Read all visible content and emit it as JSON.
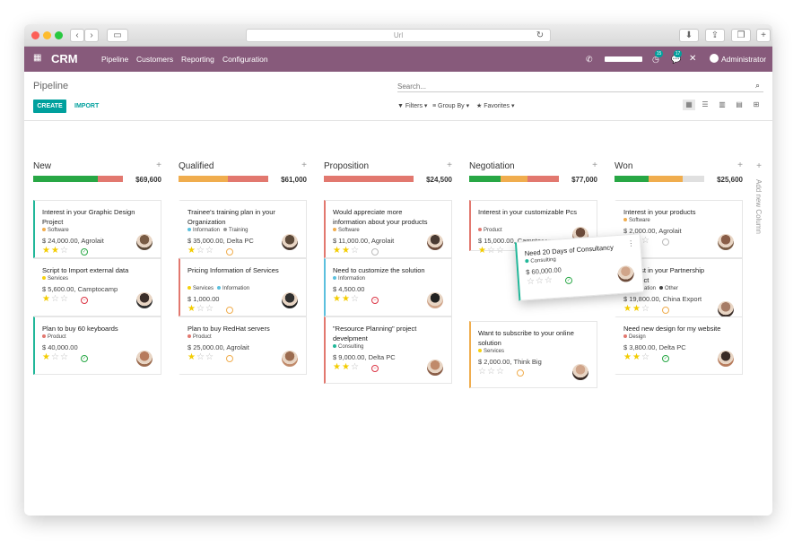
{
  "app": {
    "title": "CRM",
    "url_placeholder": "Url"
  },
  "nav": {
    "menus": [
      "Pipeline",
      "Customers",
      "Reporting",
      "Configuration"
    ],
    "user": "Administrator",
    "badge_activities": "15",
    "badge_messages": "17"
  },
  "breadcrumb": "Pipeline",
  "buttons": {
    "create": "CREATE",
    "import": "IMPORT"
  },
  "search": {
    "placeholder": "Search..."
  },
  "filters": {
    "filters": "Filters",
    "group_by": "Group By",
    "favorites": "Favorites"
  },
  "add_column": "Add new Column",
  "colors": {
    "brand": "#875a7b",
    "accent": "#00a09d",
    "green": "#21b799",
    "red": "#e2786f",
    "orange": "#f0ad4e",
    "grey": "#e0e0e0"
  },
  "columns": [
    {
      "name": "New",
      "total": "$69,600",
      "progress": [
        {
          "color": "#28a745",
          "pct": 0.72
        },
        {
          "color": "#e2786f",
          "pct": 0.28
        }
      ],
      "cards": [
        {
          "title": "Interest in your Graphic Design Project",
          "tags": [
            {
              "name": "Software",
              "color": "#f0ad4e"
            }
          ],
          "amount": "$ 24,000.00, Agrolait",
          "stars": 2,
          "status": "green",
          "border": "#21b799",
          "avatar": "a1"
        },
        {
          "title": "Script to Import external data",
          "tags": [
            {
              "name": "Services",
              "color": "#f5d10f"
            }
          ],
          "amount": "$ 5,600.00, Camptocamp",
          "stars": 1,
          "status": "red",
          "border": "",
          "avatar": "a2"
        },
        {
          "title": "Plan to buy 60 keyboards",
          "tags": [
            {
              "name": "Product",
              "color": "#e2786f"
            }
          ],
          "amount": "$ 40,000.00",
          "stars": 1,
          "status": "green",
          "border": "#21b799",
          "avatar": "a3"
        }
      ]
    },
    {
      "name": "Qualified",
      "total": "$61,000",
      "progress": [
        {
          "color": "#f0ad4e",
          "pct": 0.55
        },
        {
          "color": "#e2786f",
          "pct": 0.45
        }
      ],
      "cards": [
        {
          "title": "Trainee's training plan in your Organization",
          "tags": [
            {
              "name": "Information",
              "color": "#5bc0de"
            },
            {
              "name": "Training",
              "color": "#999"
            }
          ],
          "amount": "$ 35,000.00, Delta PC",
          "stars": 1,
          "status": "orange",
          "border": "",
          "avatar": "a4"
        },
        {
          "title": "Pricing Information of Services",
          "tags": [
            {
              "name": "Services",
              "color": "#f5d10f"
            },
            {
              "name": "Information",
              "color": "#5bc0de"
            }
          ],
          "amount": "$ 1,000.00",
          "stars": 1,
          "status": "orange",
          "border": "#e2786f",
          "avatar": "a5"
        },
        {
          "title": "Plan to buy RedHat servers",
          "tags": [
            {
              "name": "Product",
              "color": "#e2786f"
            }
          ],
          "amount": "$ 25,000.00, Agrolait",
          "stars": 1,
          "status": "orange",
          "border": "",
          "avatar": "a6"
        }
      ]
    },
    {
      "name": "Proposition",
      "total": "$24,500",
      "progress": [
        {
          "color": "#e2786f",
          "pct": 1.0
        }
      ],
      "cards": [
        {
          "title": "Would appreciate more information about your products",
          "tags": [
            {
              "name": "Software",
              "color": "#f0ad4e"
            }
          ],
          "amount": "$ 11,000.00, Agrolait",
          "stars": 2,
          "status": "grey",
          "border": "#e2786f",
          "avatar": "a7"
        },
        {
          "title": "Need to customize the solution",
          "tags": [
            {
              "name": "Information",
              "color": "#5bc0de"
            }
          ],
          "amount": "$ 4,500.00",
          "stars": 2,
          "status": "red",
          "border": "#5bc0de",
          "avatar": "a8"
        },
        {
          "title": "\"Resource Planning\" project develpment",
          "tags": [
            {
              "name": "Consulting",
              "color": "#21b799"
            }
          ],
          "amount": "$ 9,000.00, Delta PC",
          "stars": 2,
          "status": "red",
          "border": "#e2786f",
          "avatar": "a9"
        }
      ]
    },
    {
      "name": "Negotiation",
      "total": "$77,000",
      "progress": [
        {
          "color": "#28a745",
          "pct": 0.35
        },
        {
          "color": "#f0ad4e",
          "pct": 0.3
        },
        {
          "color": "#e2786f",
          "pct": 0.35
        }
      ],
      "cards": [
        {
          "title": "Interest in your customizable Pcs",
          "tags": [
            {
              "name": "Product",
              "color": "#e2786f"
            }
          ],
          "amount": "$ 15,000.00, Camptocamp",
          "stars": 1,
          "status": "red",
          "border": "#e2786f",
          "avatar": "a10"
        },
        {
          "title": "Want to subscribe to your online solution",
          "tags": [
            {
              "name": "Services",
              "color": "#f5d10f"
            }
          ],
          "amount": "$ 2,000.00, Think Big",
          "stars": 0,
          "status": "orange",
          "border": "#f0ad4e",
          "avatar": "a11"
        }
      ]
    },
    {
      "name": "Won",
      "total": "$25,600",
      "progress": [
        {
          "color": "#28a745",
          "pct": 0.38
        },
        {
          "color": "#f0ad4e",
          "pct": 0.38
        },
        {
          "color": "#e0e0e0",
          "pct": 0.24
        }
      ],
      "cards": [
        {
          "title": "Interest in your products",
          "tags": [
            {
              "name": "Software",
              "color": "#f0ad4e"
            }
          ],
          "amount": "$ 2,000.00, Agrolait",
          "stars": 2,
          "status": "grey",
          "border": "",
          "avatar": "a12"
        },
        {
          "title": "Interest in your Partnership Contract",
          "tags": [
            {
              "name": "Information",
              "color": "#5bc0de"
            },
            {
              "name": "Other",
              "color": "#444"
            }
          ],
          "amount": "$ 19,800.00, China Export",
          "stars": 2,
          "status": "orange",
          "border": "",
          "avatar": "a13"
        },
        {
          "title": "Need new design for my website",
          "tags": [
            {
              "name": "Design",
              "color": "#e2786f"
            }
          ],
          "amount": "$ 3,800.00, Delta PC",
          "stars": 2,
          "status": "green",
          "border": "",
          "avatar": "a14"
        }
      ]
    }
  ],
  "drag_card": {
    "title": "Need 20 Days of Consultancy",
    "tags": [
      {
        "name": "Consulting",
        "color": "#21b799"
      }
    ],
    "amount": "$ 60,000.00",
    "stars": 0,
    "status": "green"
  }
}
